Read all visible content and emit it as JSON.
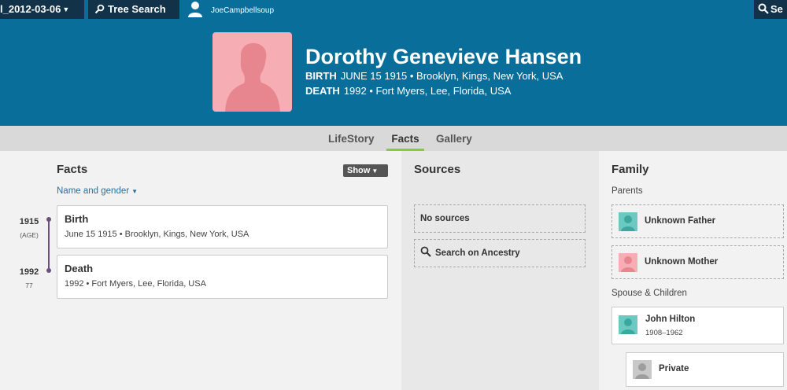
{
  "topbar": {
    "tree_name": "l_2012-03-06",
    "tree_search": "Tree Search",
    "username": "JoeCampbellsoup",
    "search_label": "Se"
  },
  "person": {
    "name": "Dorothy Genevieve Hansen",
    "birth_label": "BIRTH",
    "birth_value": "JUNE 15 1915 • Brooklyn, Kings, New York, USA",
    "death_label": "DEATH",
    "death_value": "1992 • Fort Myers, Lee, Florida, USA"
  },
  "tabs": [
    "LifeStory",
    "Facts",
    "Gallery"
  ],
  "active_tab": "Facts",
  "facts": {
    "title": "Facts",
    "show_label": "Show",
    "name_gender": "Name and gender",
    "timeline": [
      {
        "year": "1915",
        "sub": "(AGE)"
      },
      {
        "year": "1992",
        "sub": "77"
      }
    ],
    "events": [
      {
        "title": "Birth",
        "detail": "June 15 1915 • Brooklyn, Kings, New York, USA"
      },
      {
        "title": "Death",
        "detail": "1992 • Fort Myers, Lee, Florida, USA"
      }
    ]
  },
  "sources": {
    "title": "Sources",
    "no_sources": "No sources",
    "search_ancestry": "Search on Ancestry"
  },
  "family": {
    "title": "Family",
    "parents_label": "Parents",
    "parents": [
      {
        "name": "Unknown Father",
        "gender": "male"
      },
      {
        "name": "Unknown Mother",
        "gender": "female"
      }
    ],
    "spouse_label": "Spouse & Children",
    "spouse": {
      "name": "John Hilton",
      "dates": "1908–1962"
    },
    "child": {
      "name": "Private"
    }
  },
  "colors": {
    "header_blue": "#0a6e9b",
    "dark_navy": "#12324a",
    "female_pink": "#f6adb4",
    "male_teal": "#6cc9c1",
    "active_tab_underline": "#8dc63f",
    "timeline_purple": "#6b4f7d"
  }
}
